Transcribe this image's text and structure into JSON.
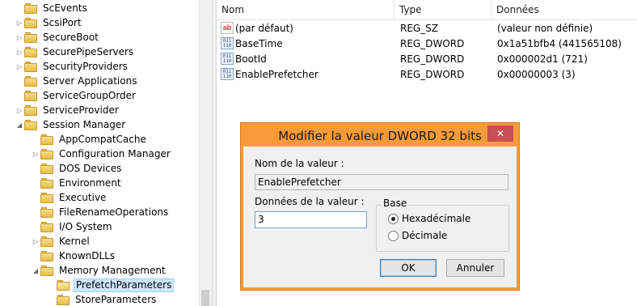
{
  "tree": {
    "items": [
      {
        "label": "ScEvents",
        "indent": 0,
        "expander": "none"
      },
      {
        "label": "ScsiPort",
        "indent": 0,
        "expander": "collapsed"
      },
      {
        "label": "SecureBoot",
        "indent": 0,
        "expander": "collapsed"
      },
      {
        "label": "SecurePipeServers",
        "indent": 0,
        "expander": "collapsed"
      },
      {
        "label": "SecurityProviders",
        "indent": 0,
        "expander": "collapsed"
      },
      {
        "label": "Server Applications",
        "indent": 0,
        "expander": "none"
      },
      {
        "label": "ServiceGroupOrder",
        "indent": 0,
        "expander": "none"
      },
      {
        "label": "ServiceProvider",
        "indent": 0,
        "expander": "collapsed"
      },
      {
        "label": "Session Manager",
        "indent": 0,
        "expander": "expanded"
      },
      {
        "label": "AppCompatCache",
        "indent": 1,
        "expander": "none"
      },
      {
        "label": "Configuration Manager",
        "indent": 1,
        "expander": "collapsed"
      },
      {
        "label": "DOS Devices",
        "indent": 1,
        "expander": "none"
      },
      {
        "label": "Environment",
        "indent": 1,
        "expander": "none"
      },
      {
        "label": "Executive",
        "indent": 1,
        "expander": "none"
      },
      {
        "label": "FileRenameOperations",
        "indent": 1,
        "expander": "none"
      },
      {
        "label": "I/O System",
        "indent": 1,
        "expander": "none"
      },
      {
        "label": "Kernel",
        "indent": 1,
        "expander": "collapsed"
      },
      {
        "label": "KnownDLLs",
        "indent": 1,
        "expander": "none"
      },
      {
        "label": "Memory Management",
        "indent": 1,
        "expander": "expanded"
      },
      {
        "label": "PrefetchParameters",
        "indent": 2,
        "expander": "none",
        "selected": true
      },
      {
        "label": "StoreParameters",
        "indent": 2,
        "expander": "none"
      }
    ]
  },
  "list": {
    "columns": {
      "name": "Nom",
      "type": "Type",
      "data": "Données"
    },
    "rows": [
      {
        "icon": "string-value-icon",
        "name": "(par défaut)",
        "type": "REG_SZ",
        "data": "(valeur non définie)"
      },
      {
        "icon": "binary-value-icon",
        "name": "BaseTime",
        "type": "REG_DWORD",
        "data": "0x1a51bfb4 (441565108)"
      },
      {
        "icon": "binary-value-icon",
        "name": "BootId",
        "type": "REG_DWORD",
        "data": "0x000002d1 (721)"
      },
      {
        "icon": "binary-value-icon",
        "name": "EnablePrefetcher",
        "type": "REG_DWORD",
        "data": "0x00000003 (3)"
      }
    ]
  },
  "dialog": {
    "title": "Modifier la valeur DWORD 32 bits",
    "close_glyph": "✕",
    "name_label": "Nom de la valeur :",
    "name_value": "EnablePrefetcher",
    "data_label": "Données de la valeur :",
    "data_value": "3",
    "base_label": "Base",
    "radio_hex": "Hexadécimale",
    "radio_dec": "Décimale",
    "ok": "OK",
    "cancel": "Annuler",
    "selected_base": "hex"
  },
  "colors": {
    "dialog_frame": "#f79a3a",
    "close_button": "#c75050",
    "selection": "#cce8ff",
    "folder": "#e6bd4a"
  }
}
